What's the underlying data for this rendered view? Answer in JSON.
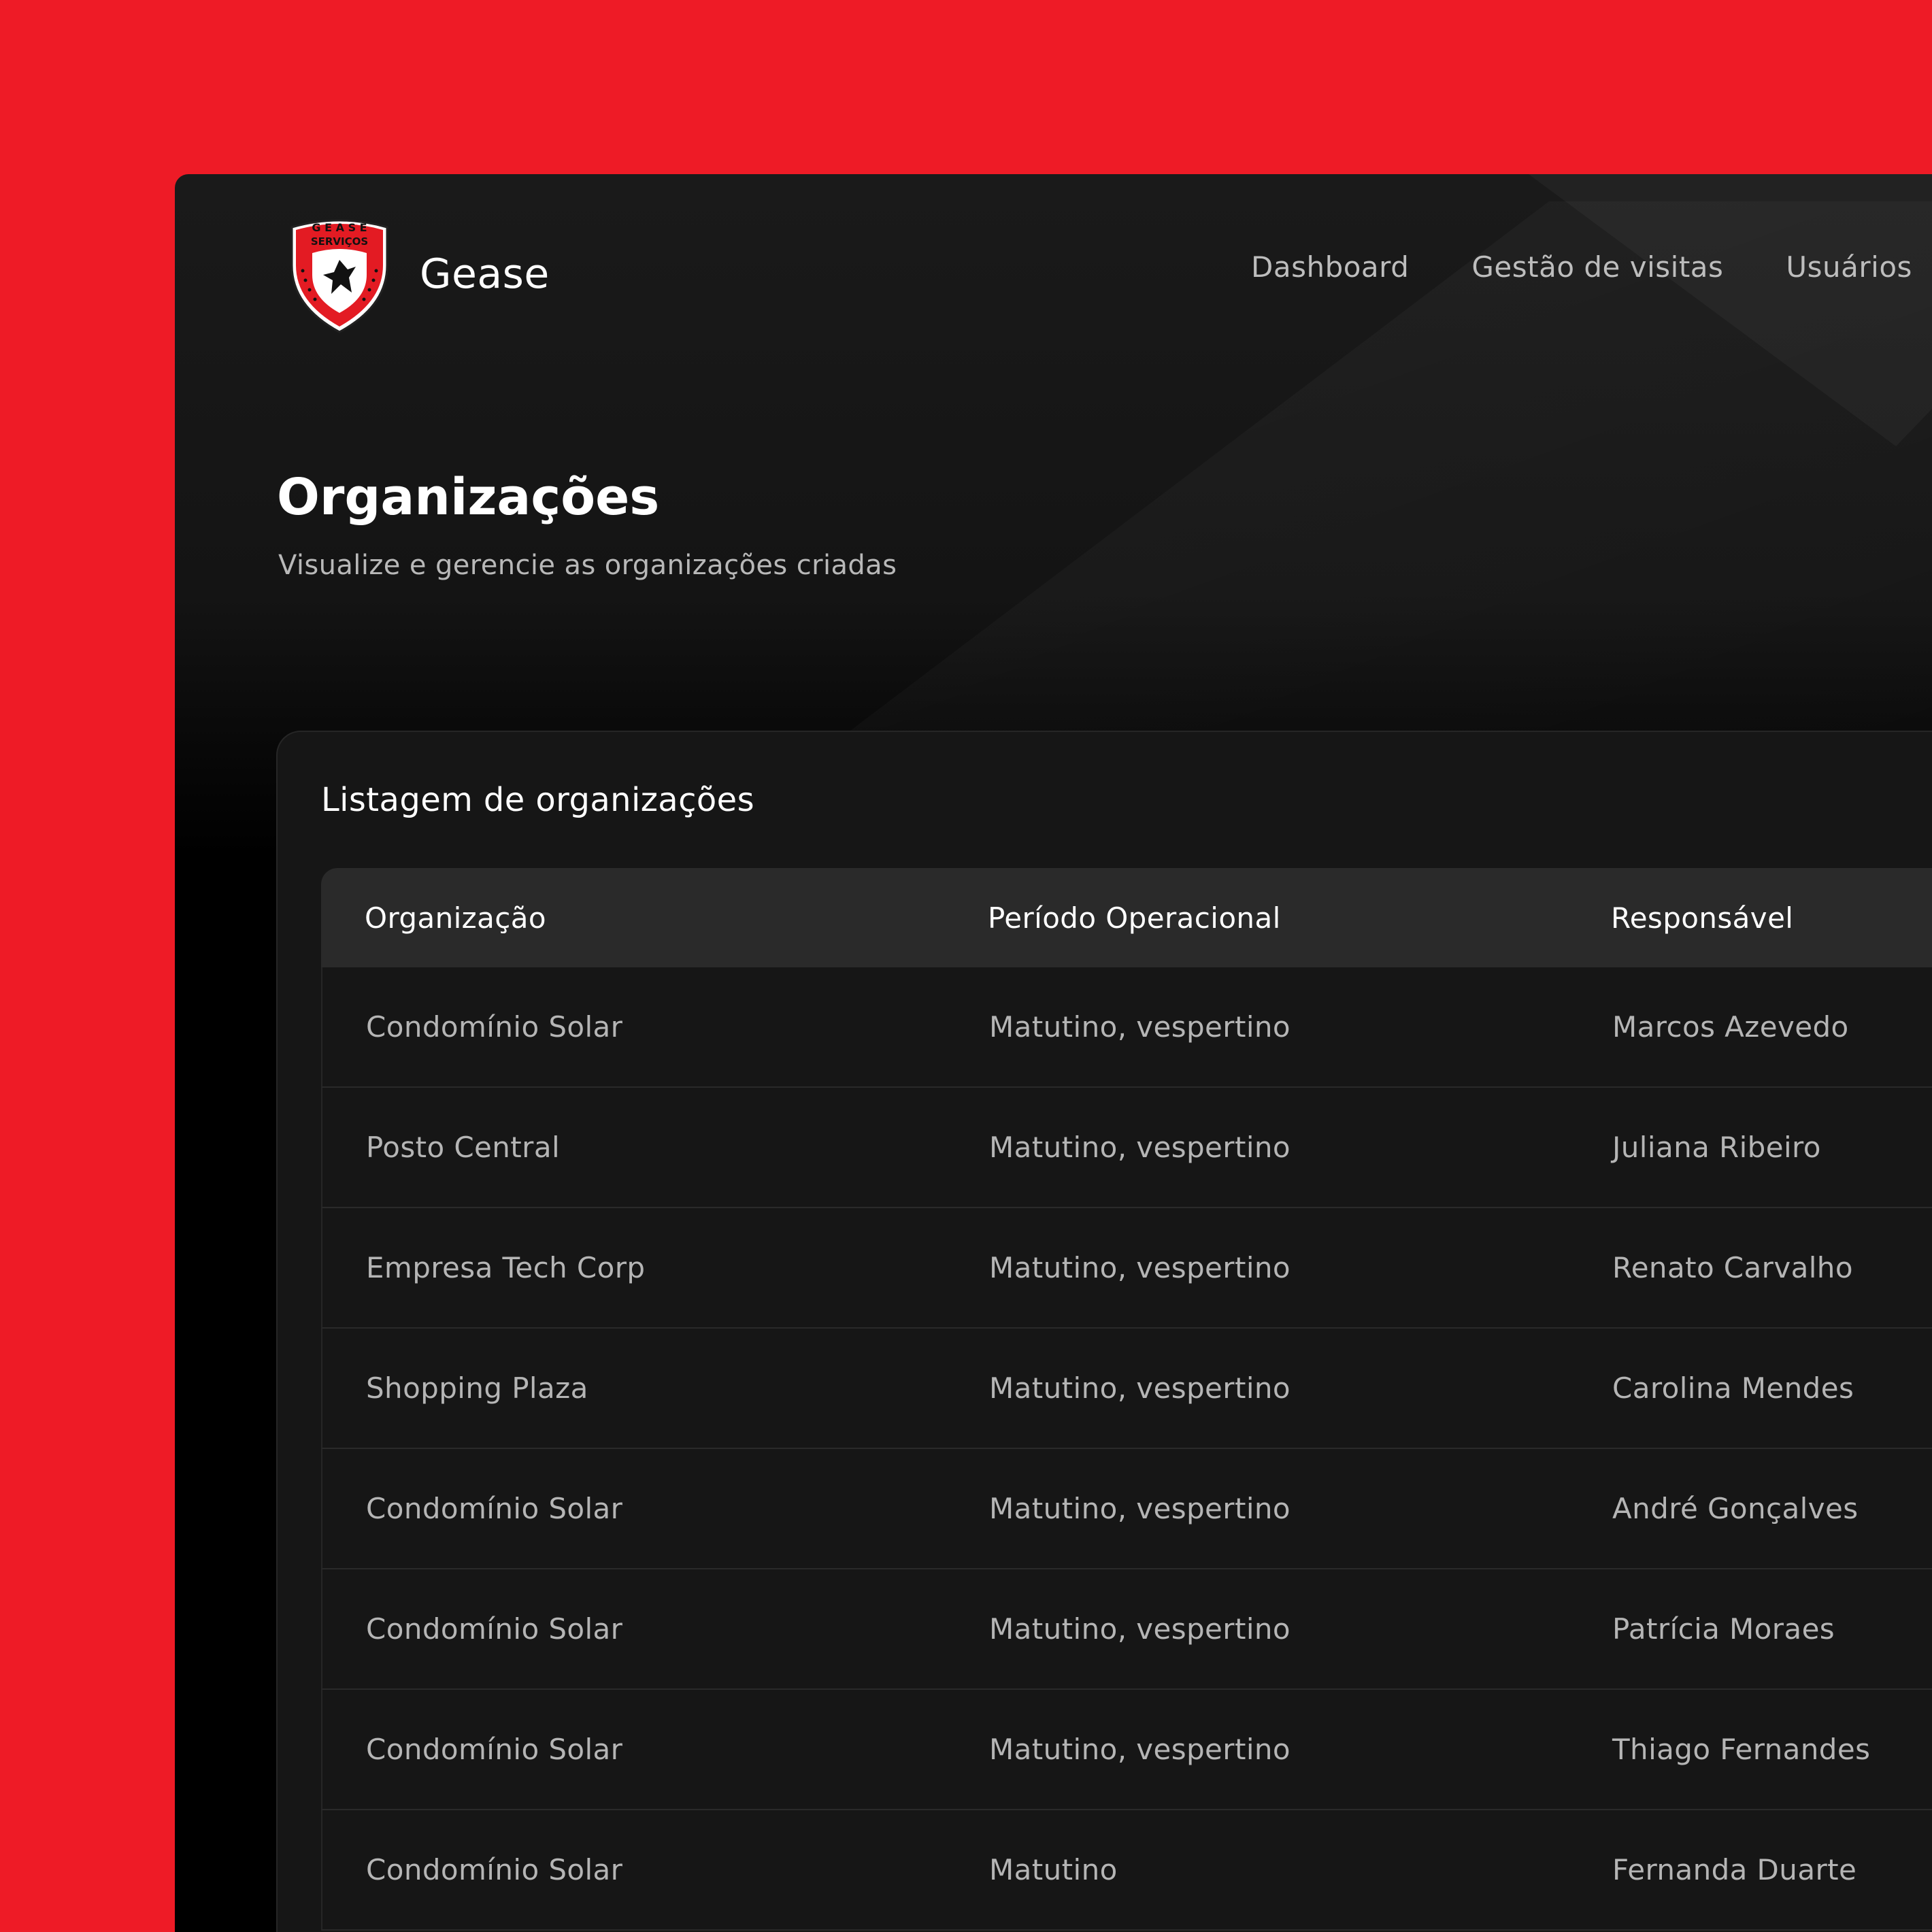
{
  "app": {
    "name": "Gease",
    "logo_text_top": "G E A S E",
    "logo_text_mid": "SERVIÇOS"
  },
  "nav": {
    "items": [
      "Dashboard",
      "Gestão de visitas",
      "Usuários"
    ]
  },
  "page": {
    "title": "Organizações",
    "subtitle": "Visualize e gerencie as organizações criadas"
  },
  "panel": {
    "title": "Listagem de organizações"
  },
  "table": {
    "columns": [
      "Organização",
      "Período Operacional",
      "Responsável"
    ],
    "rows": [
      [
        "Condomínio Solar",
        "Matutino, vespertino",
        "Marcos Azevedo"
      ],
      [
        "Posto Central",
        "Matutino, vespertino",
        "Juliana Ribeiro"
      ],
      [
        "Empresa Tech Corp",
        "Matutino, vespertino",
        "Renato Carvalho"
      ],
      [
        "Shopping Plaza",
        "Matutino, vespertino",
        "Carolina Mendes"
      ],
      [
        "Condomínio Solar",
        "Matutino, vespertino",
        "André Gonçalves"
      ],
      [
        "Condomínio Solar",
        "Matutino, vespertino",
        "Patrícia Moraes"
      ],
      [
        "Condomínio Solar",
        "Matutino, vespertino",
        "Thiago Fernandes"
      ],
      [
        "Condomínio Solar",
        "Matutino",
        "Fernanda Duarte"
      ]
    ]
  },
  "colors": {
    "accent": "#ee1b26",
    "background": "#000000",
    "panel": "#161616",
    "header_row": "#2a2a2a"
  }
}
